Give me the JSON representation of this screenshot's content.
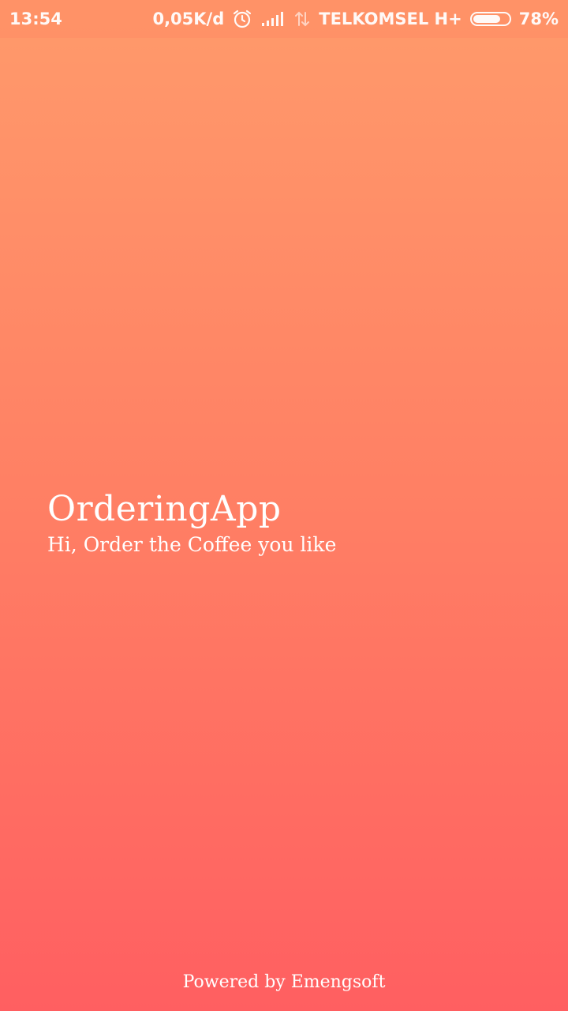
{
  "status_bar": {
    "time": "13:54",
    "data_speed": "0,05K/d",
    "carrier": "TELKOMSEL H+",
    "battery_percent_text": "78%",
    "battery_level": 0.78,
    "icons": [
      "alarm-icon",
      "signal-icon",
      "data-transfer-icon",
      "battery-icon"
    ]
  },
  "splash": {
    "title": "OrderingApp",
    "subtitle": "Hi, Order the Coffee you like"
  },
  "footer": {
    "powered_by": "Powered by Emengsoft"
  },
  "colors": {
    "gradient_top": "#ff9a6b",
    "gradient_bottom": "#ff5f61",
    "text": "#ffffff"
  }
}
